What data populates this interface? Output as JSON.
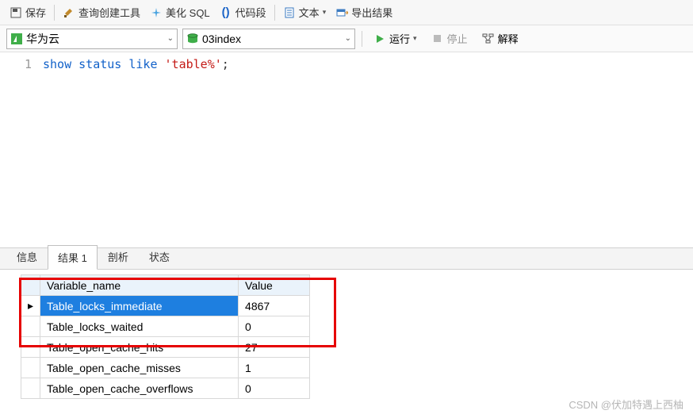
{
  "toolbar": {
    "save": "保存",
    "query_builder": "查询创建工具",
    "beautify": "美化 SQL",
    "snippets": "代码段",
    "text": "文本",
    "export": "导出结果"
  },
  "secondbar": {
    "connection": "华为云",
    "database": "03index",
    "run": "运行",
    "stop": "停止",
    "explain": "解释"
  },
  "editor": {
    "line_no": "1",
    "kw_show": "show",
    "kw_status": "status",
    "kw_like": "like",
    "str_lit": "'table%'",
    "semi": ";"
  },
  "tabs": {
    "info": "信息",
    "result": "结果 1",
    "profile": "剖析",
    "status": "状态"
  },
  "grid": {
    "headers": {
      "name": "Variable_name",
      "value": "Value"
    },
    "rows": [
      {
        "name": "Table_locks_immediate",
        "value": "4867",
        "selected": true
      },
      {
        "name": "Table_locks_waited",
        "value": "0"
      },
      {
        "name": "Table_open_cache_hits",
        "value": "27"
      },
      {
        "name": "Table_open_cache_misses",
        "value": "1"
      },
      {
        "name": "Table_open_cache_overflows",
        "value": "0"
      }
    ]
  },
  "watermark": "CSDN @伏加特遇上西柚"
}
